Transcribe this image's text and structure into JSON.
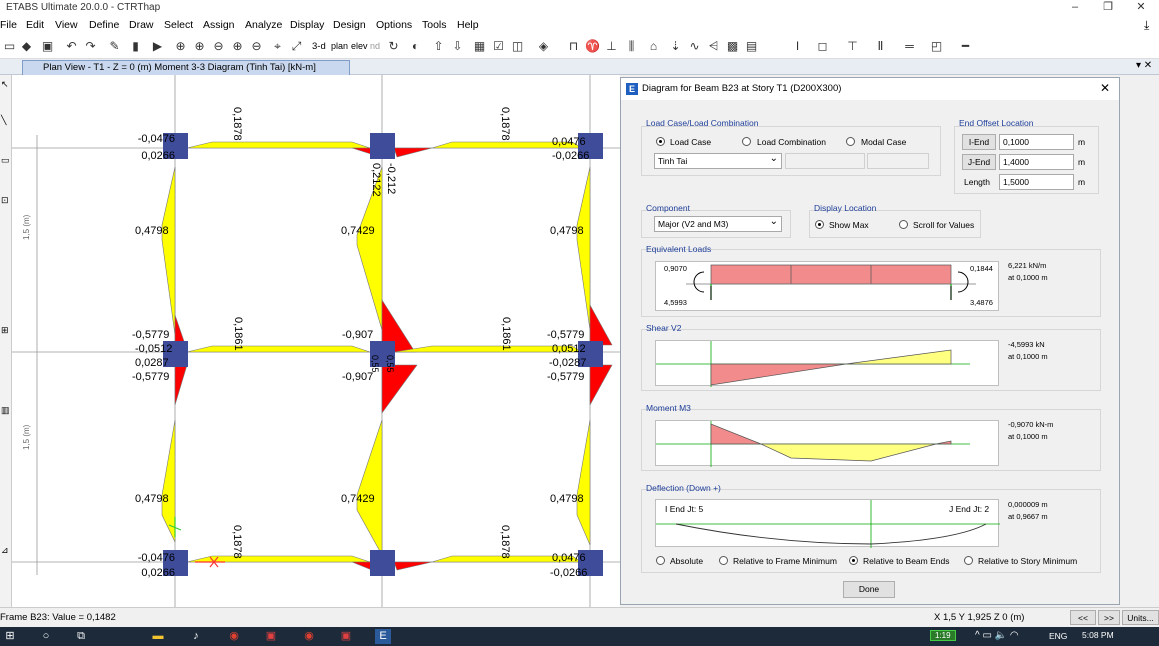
{
  "window": {
    "title": "ETABS Ultimate 20.0.0 - CTRThap"
  },
  "menu": [
    "File",
    "Edit",
    "View",
    "Define",
    "Draw",
    "Select",
    "Assign",
    "Analyze",
    "Display",
    "Design",
    "Options",
    "Tools",
    "Help"
  ],
  "toolbar": {
    "view_3d": "3-d",
    "plan": "plan",
    "elev": "elev",
    "nd": "nd"
  },
  "doc_tab": {
    "label": "Plan View - T1 - Z = 0 (m)   Moment 3-3 Diagram   (Tinh Tai)  [kN-m]"
  },
  "plan": {
    "left_top_labels": [
      "-0,0476",
      "0,0266"
    ],
    "right_top_labels": [
      "0,0476",
      "-0,0266"
    ],
    "top_beam_labels": [
      "0,1878",
      "0,1878"
    ],
    "center_top_labels": [
      "0,2122",
      "-0,212"
    ],
    "mid_column_labels_upper": [
      "0,4798",
      "0,7429",
      "0,4798"
    ],
    "mid_row_left": [
      "-0,5779",
      "-0,0512",
      "0,0287",
      "-0,5779"
    ],
    "mid_row_center": [
      "-0,907",
      "-0,907"
    ],
    "mid_row_right": [
      "-0,5779",
      "0,0512",
      "-0,0287",
      "-0,5779"
    ],
    "mid_beam_labels": [
      "0,1861",
      "0,1861"
    ],
    "center_mid_labels": [
      "0,55",
      "0,55"
    ],
    "mid_column_labels_lower": [
      "0,4798",
      "0,7429",
      "0,4798"
    ],
    "bottom_beam_labels": [
      "0,1878",
      "0,1878"
    ],
    "left_bottom_labels": [
      "-0,0476",
      "0,0266"
    ],
    "right_bottom_labels": [
      "0,0476",
      "-0,0266"
    ],
    "dimension_labels": [
      "1,5 (m)",
      "1,5 (m)"
    ]
  },
  "dialog": {
    "title": "Diagram for Beam B23 at Story T1 (D200X300)",
    "load_group_label": "Load Case/Load Combination",
    "radio_load_case": "Load Case",
    "radio_load_combination": "Load Combination",
    "radio_modal_case": "Modal Case",
    "load_case_value": "Tinh Tai",
    "end_offset_label": "End Offset Location",
    "i_end_label": "I-End",
    "i_end_value": "0,1000",
    "j_end_label": "J-End",
    "j_end_value": "1,4000",
    "length_label": "Length",
    "length_value": "1,5000",
    "unit_m": "m",
    "component_label": "Component",
    "component_value": "Major (V2 and M3)",
    "display_location_label": "Display Location",
    "radio_show_max": "Show Max",
    "radio_scroll": "Scroll for Values",
    "equiv_loads_label": "Equivalent Loads",
    "eq_left_top": "0,9070",
    "eq_left_bottom": "4,5993",
    "eq_right_top": "0,1844",
    "eq_right_bottom": "3,4876",
    "eq_value": "6,221 kN/m",
    "eq_at": "at 0,1000 m",
    "shear_label": "Shear V2",
    "shear_value": "-4,5993 kN",
    "shear_at": "at 0,1000 m",
    "moment_label": "Moment M3",
    "moment_value": "-0,9070 kN-m",
    "moment_at": "at 0,1000 m",
    "deflection_label": "Deflection (Down +)",
    "defl_i_end": "I End Jt: 5",
    "defl_j_end": "J End Jt: 2",
    "defl_value": "0,000009 m",
    "defl_at": "at 0,9667 m",
    "radio_absolute": "Absolute",
    "radio_rel_frame": "Relative to Frame Minimum",
    "radio_rel_beam": "Relative to Beam Ends",
    "radio_rel_story": "Relative to Story Minimum",
    "done_label": "Done"
  },
  "status": {
    "left": "Frame B23:  Value = 0,1482",
    "coords": "X 1,5  Y 1,925  Z 0 (m)",
    "prev": "<<",
    "next": ">>",
    "units": "Units..."
  },
  "taskbar": {
    "time": "5:08 PM",
    "lang": "ENG",
    "badge": "1:19"
  }
}
